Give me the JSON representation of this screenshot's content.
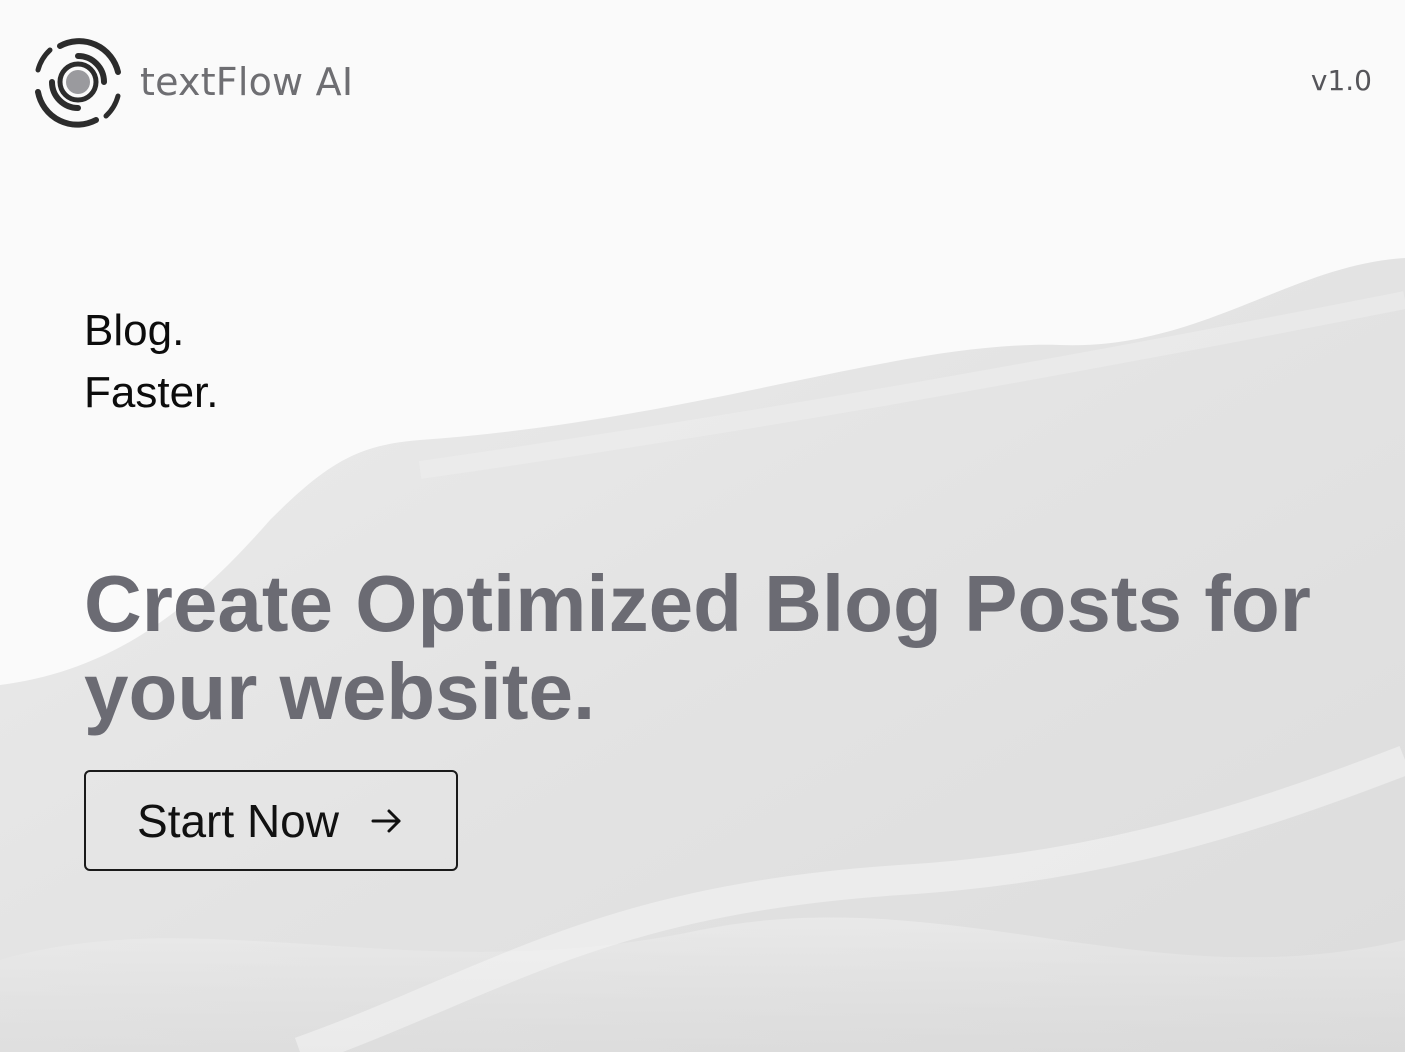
{
  "header": {
    "brand_name": "textFlow AI",
    "logo_icon": "swirl-logo-icon",
    "version": "v1.0"
  },
  "hero": {
    "tagline": [
      "Blog.",
      "Faster."
    ],
    "headline": "Create Optimized Blog Posts for your website.",
    "cta_label": "Start Now",
    "cta_icon": "arrow-right-icon"
  },
  "colors": {
    "headline": "#6b6b73",
    "brand_text": "#6e6e72",
    "background_wave": "#e6e6e6"
  }
}
